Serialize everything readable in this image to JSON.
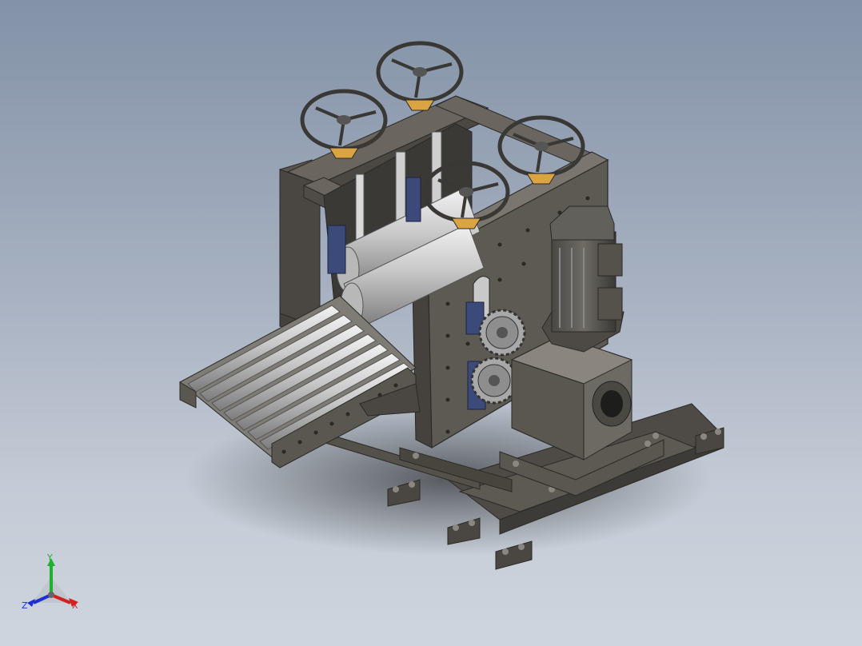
{
  "viewport": {
    "background_top": "#8392a7",
    "background_bottom": "#cfd5de",
    "model": "roller-mill-assembly"
  },
  "triad": {
    "x_label": "X",
    "y_label": "Y",
    "z_label": "Z",
    "x_color": "#d22020",
    "y_color": "#20b030",
    "z_color": "#2030d0"
  },
  "colors": {
    "steel": "#5b5852",
    "steel_light": "#7a766f",
    "steel_dark": "#3c3a36",
    "roller": "#c9c9c9",
    "bearing": "#3b4a78",
    "pad": "#d9a441"
  }
}
